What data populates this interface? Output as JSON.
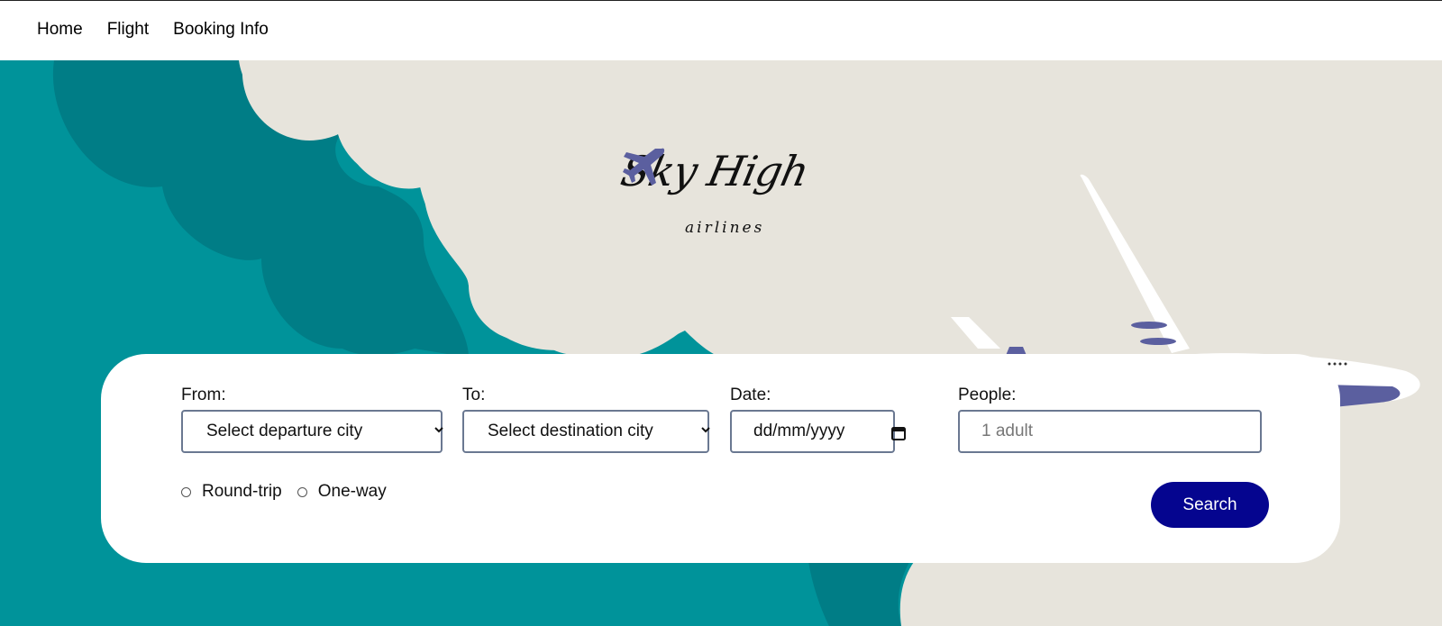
{
  "nav": {
    "items": [
      {
        "label": "Home"
      },
      {
        "label": "Flight"
      },
      {
        "label": "Booking Info"
      }
    ]
  },
  "logo": {
    "name": "Sky High",
    "sub": "airlines",
    "icon": "airplane-icon"
  },
  "form": {
    "from": {
      "label": "From:",
      "value": "Select departure city"
    },
    "to": {
      "label": "To:",
      "value": "Select destination city"
    },
    "date": {
      "label": "Date:",
      "placeholder": "dd/mm/yyyy"
    },
    "people": {
      "label": "People:",
      "placeholder": "1 adult"
    },
    "trip_types": [
      {
        "label": "Round-trip",
        "selected": false
      },
      {
        "label": "One-way",
        "selected": false
      }
    ],
    "search_label": "Search"
  },
  "colors": {
    "teal": "#00939a",
    "dark_teal": "#007d86",
    "cream": "#e7e4dc",
    "button": "#05058f",
    "plane_accent": "#5b5f9f"
  }
}
